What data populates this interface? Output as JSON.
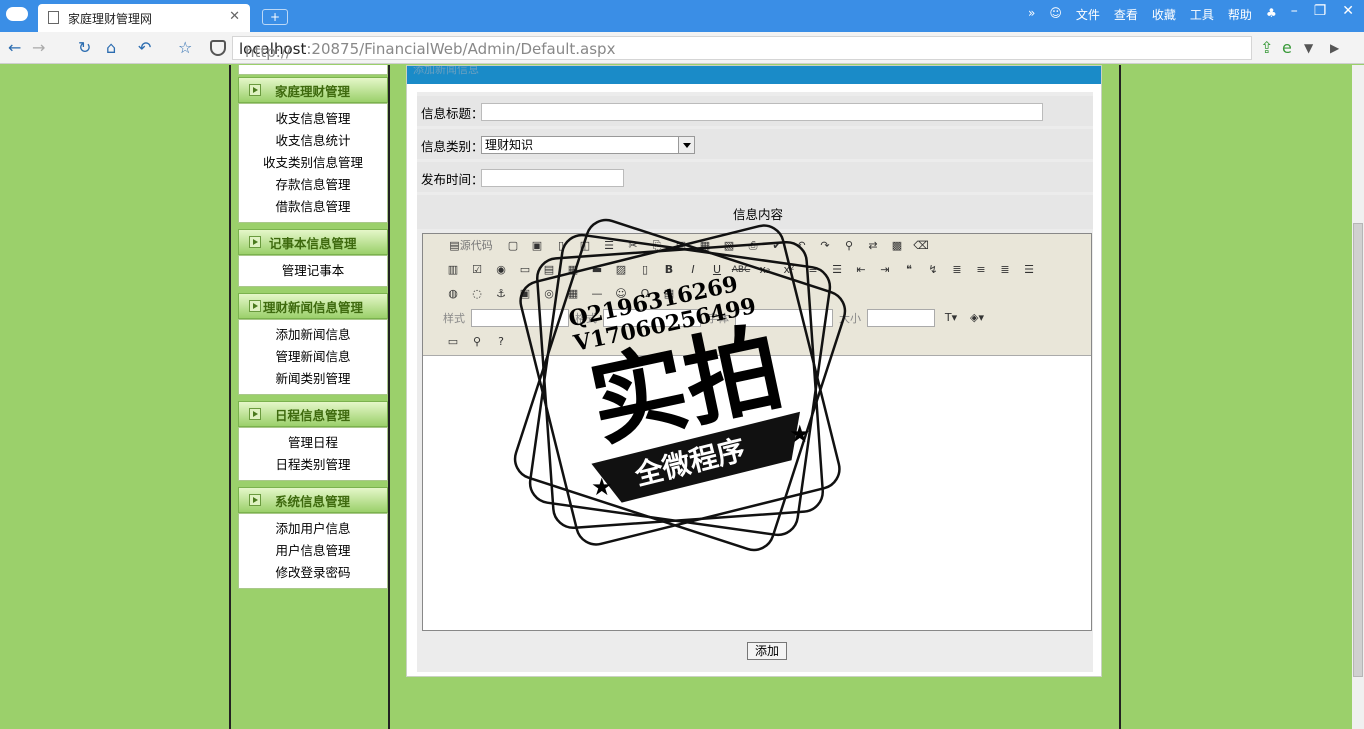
{
  "browser": {
    "tab_title": "家庭理财管理网",
    "url_prefix": "http://",
    "url_host": "localhost",
    "url_rest": ":20875/FinancialWeb/Admin/Default.aspx",
    "menu": [
      "文件",
      "查看",
      "收藏",
      "工具",
      "帮助"
    ]
  },
  "sidebar": {
    "sections": [
      {
        "title": "家庭理财管理",
        "items": [
          "收支信息管理",
          "收支信息统计",
          "收支类别信息管理",
          "存款信息管理",
          "借款信息管理"
        ]
      },
      {
        "title": "记事本信息管理",
        "items": [
          "管理记事本"
        ]
      },
      {
        "title": "理财新闻信息管理",
        "items": [
          "添加新闻信息",
          "管理新闻信息",
          "新闻类别管理"
        ]
      },
      {
        "title": "日程信息管理",
        "items": [
          "管理日程",
          "日程类别管理"
        ]
      },
      {
        "title": "系统信息管理",
        "items": [
          "添加用户信息",
          "用户信息管理",
          "修改登录密码"
        ]
      }
    ]
  },
  "form": {
    "header": "添加新闻信息",
    "title_label": "信息标题：",
    "title_value": "",
    "category_label": "信息类别：",
    "category_value": "理财知识",
    "date_label": "发布时间：",
    "date_value": "",
    "content_label": "信息内容",
    "submit_label": "添加"
  },
  "editor_toolbar": {
    "source_label": "源代码",
    "style_label": "样式",
    "format_label": "格式",
    "font_label": "字体",
    "size_label": "大小"
  },
  "watermark": {
    "qq": "Q2196316269",
    "wx": "V17060256499",
    "big": "实拍",
    "ribbon": "全微程序"
  }
}
